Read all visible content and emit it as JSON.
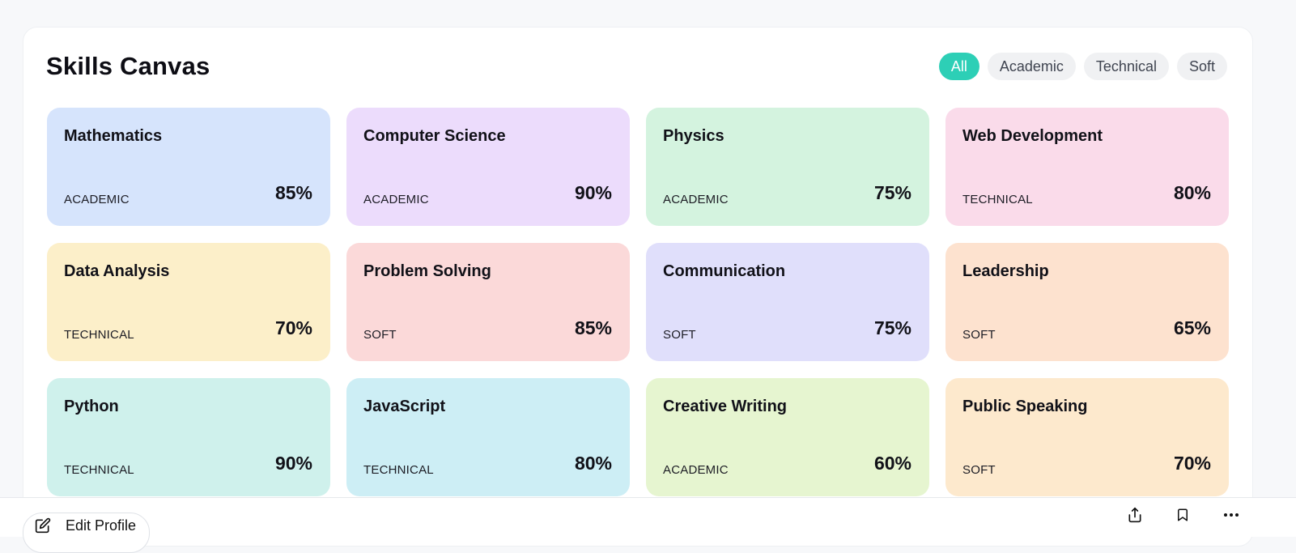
{
  "page": {
    "title": "Skills Canvas"
  },
  "filters": [
    {
      "label": "All",
      "active": true
    },
    {
      "label": "Academic",
      "active": false
    },
    {
      "label": "Technical",
      "active": false
    },
    {
      "label": "Soft",
      "active": false
    }
  ],
  "colors": {
    "accent": "#2dcfb6"
  },
  "skills": [
    {
      "name": "Mathematics",
      "category": "ACADEMIC",
      "percent": "85%",
      "color": "#d6e4fc"
    },
    {
      "name": "Computer Science",
      "category": "ACADEMIC",
      "percent": "90%",
      "color": "#ecdcfc"
    },
    {
      "name": "Physics",
      "category": "ACADEMIC",
      "percent": "75%",
      "color": "#d4f3df"
    },
    {
      "name": "Web Development",
      "category": "TECHNICAL",
      "percent": "80%",
      "color": "#fadbea"
    },
    {
      "name": "Data Analysis",
      "category": "TECHNICAL",
      "percent": "70%",
      "color": "#fcefc9"
    },
    {
      "name": "Problem Solving",
      "category": "SOFT",
      "percent": "85%",
      "color": "#fbd9d9"
    },
    {
      "name": "Communication",
      "category": "SOFT",
      "percent": "75%",
      "color": "#e0dffb"
    },
    {
      "name": "Leadership",
      "category": "SOFT",
      "percent": "65%",
      "color": "#fde2cf"
    },
    {
      "name": "Python",
      "category": "TECHNICAL",
      "percent": "90%",
      "color": "#cff1ec"
    },
    {
      "name": "JavaScript",
      "category": "TECHNICAL",
      "percent": "80%",
      "color": "#cdeef5"
    },
    {
      "name": "Creative Writing",
      "category": "ACADEMIC",
      "percent": "60%",
      "color": "#e6f5d0"
    },
    {
      "name": "Public Speaking",
      "category": "SOFT",
      "percent": "70%",
      "color": "#fde9cd"
    }
  ],
  "bottom_bar": {
    "edit_label": "Edit Profile",
    "edit_icon": "pencil-square-icon",
    "actions": [
      "share-icon",
      "bookmark-icon",
      "more-icon"
    ]
  }
}
